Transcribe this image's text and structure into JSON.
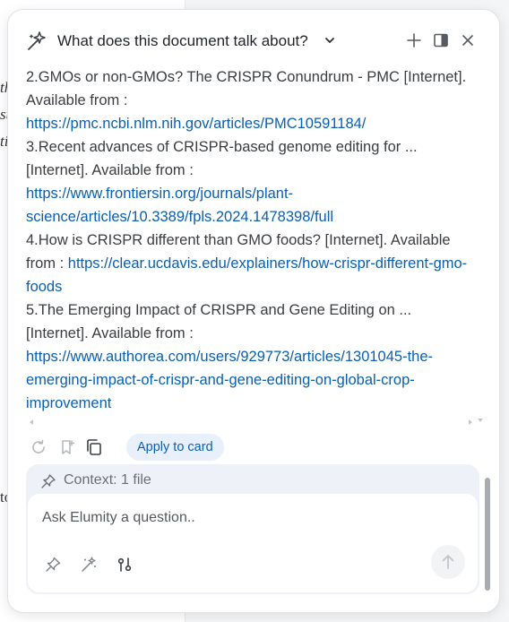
{
  "background": {
    "fragments": [
      "th",
      "su",
      "til",
      "to"
    ]
  },
  "header": {
    "title": "What does this document talk about?",
    "icons": [
      "sparkles-icon",
      "chevron-down-icon",
      "plus-icon",
      "split-panel-icon",
      "close-icon"
    ]
  },
  "references": [
    {
      "text": "2.GMOs or non-GMOs? The CRISPR Conundrum - PMC [Internet]. Available from :",
      "url": "https://pmc.ncbi.nlm.nih.gov/articles/PMC10591184/"
    },
    {
      "text": "3.Recent advances of CRISPR-based genome editing for ... [Internet]. Available from :",
      "url": "https://www.frontiersin.org/journals/plant-science/articles/10.3389/fpls.2024.1478398/full"
    },
    {
      "text": "4.How is CRISPR different than GMO foods? [Internet]. Available from :",
      "url": "https://clear.ucdavis.edu/explainers/how-crispr-different-gmo-foods"
    },
    {
      "text": "5.The Emerging Impact of CRISPR and Gene Editing on ... [Internet]. Available from :",
      "url": "https://www.authorea.com/users/929773/articles/1301045-the-emerging-impact-of-crispr-and-gene-editing-on-global-crop-improvement"
    }
  ],
  "toolbar": {
    "apply_label": "Apply to card",
    "icons": [
      "regenerate-icon",
      "bookmark-icon",
      "copy-icon"
    ]
  },
  "composer": {
    "context_label": "Context: 1 file",
    "placeholder": "Ask Elumity a question..",
    "icons": [
      "pin-icon",
      "magic-wand-icon",
      "model-switch-icon",
      "send-arrow-icon"
    ]
  },
  "colors": {
    "link": "#0b5fb0",
    "apply_bg": "#e8f0fb",
    "composer_bg": "#eef2f8"
  }
}
